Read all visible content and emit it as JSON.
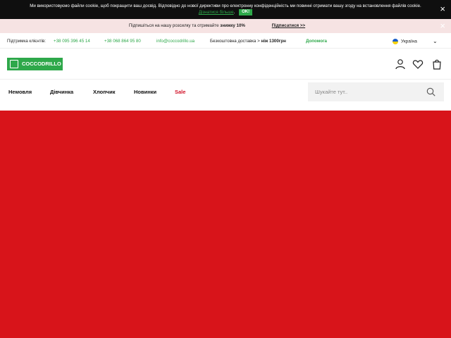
{
  "cookie_bar": {
    "text": "Ми використовуємо файли cookie, щоб покращити ваш досвід. Відповідно до нової директиви про електронну конфіденційність ми повинні отримати вашу згоду на встановлення файлів cookie.",
    "link": "Дізнатися більше",
    "ok_label": "OK!",
    "close_icon": "×"
  },
  "newsletter_bar": {
    "text": "Підпишіться на нашу розсилку та отримайте",
    "discount": "знижку 10%",
    "link": "Підписатися >>",
    "close_icon": "×",
    "background": "#f6e3e3"
  },
  "info_bar": {
    "support_label": "Підтримка клієнтів:",
    "phone1": "+38 095 396 45 14",
    "phone2": "+38 068 864 95 80",
    "email": "info@coccodrillo.ua",
    "delivery_text": "Безкоштовна доставка >",
    "delivery_bold": "ніж 1300грн",
    "help_link": "Допомога",
    "language": "Україна"
  },
  "header": {
    "logo_text": "COCCODRILLO",
    "icons": [
      "user-icon",
      "heart-icon",
      "bag-icon"
    ]
  },
  "nav": {
    "items": [
      "Немовля",
      "Дівчинка",
      "Хлопчик",
      "Новинки"
    ],
    "sale": "Sale"
  },
  "search": {
    "placeholder": "Шукайте тут.."
  },
  "colors": {
    "accent": "#2ea84a",
    "sale": "#d2142a",
    "hero": "#d8141a",
    "cookie_bar": "#0f0f0f"
  }
}
